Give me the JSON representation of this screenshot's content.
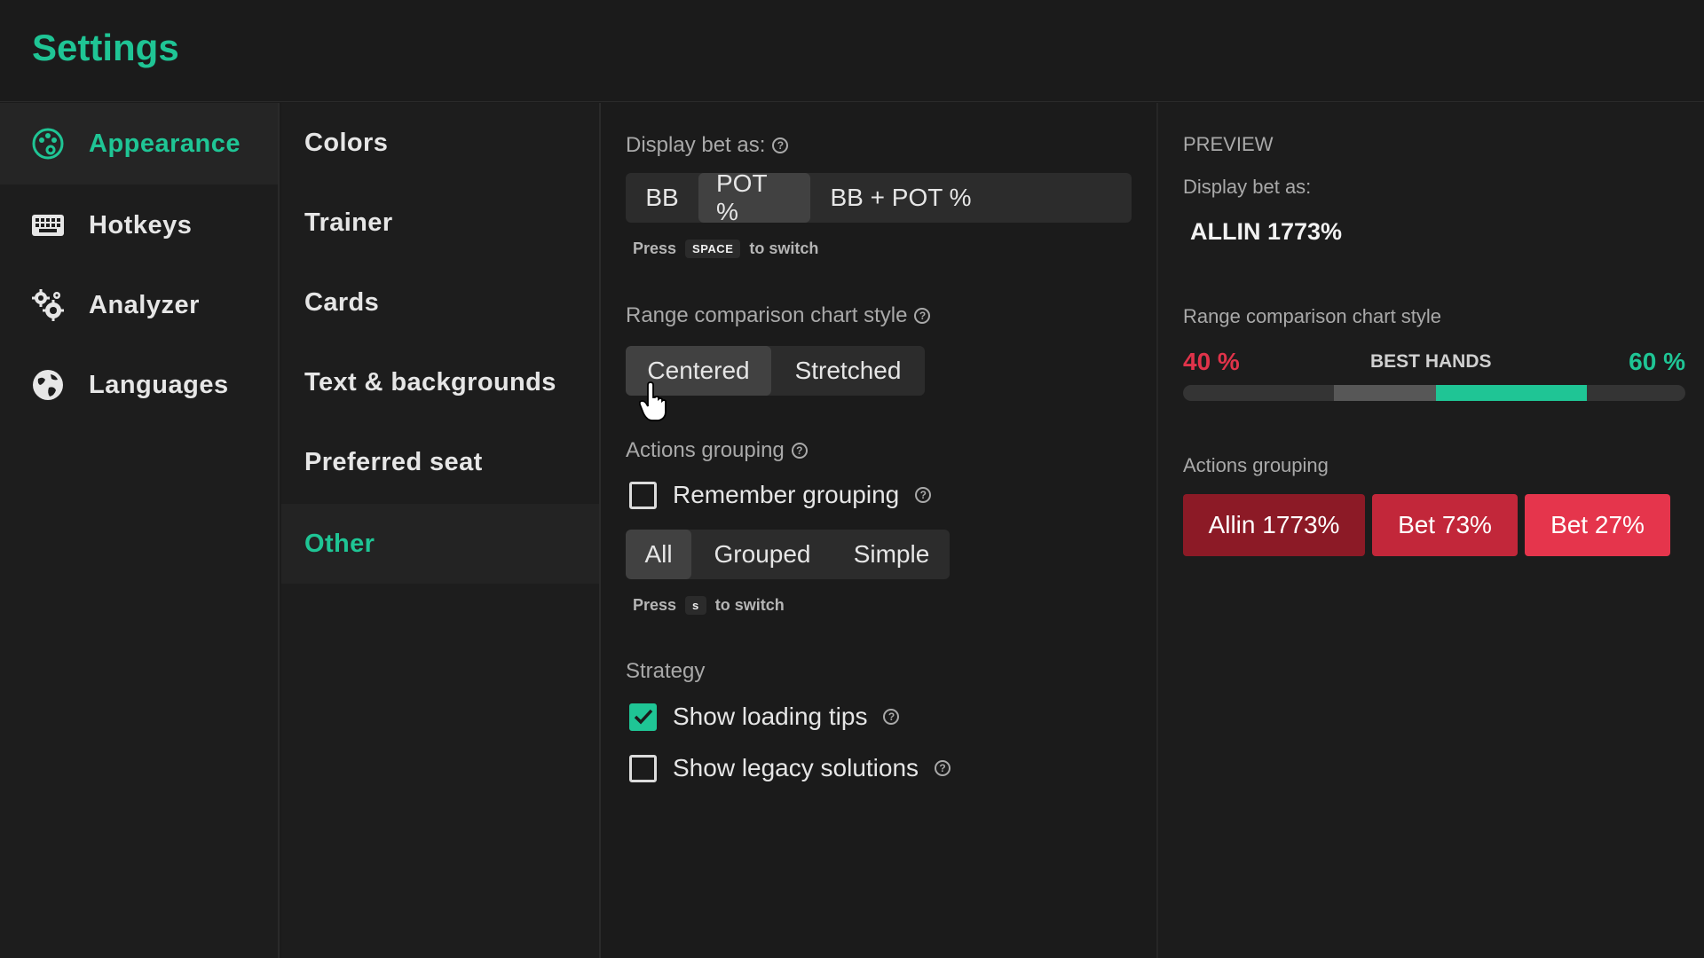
{
  "header": {
    "title": "Settings"
  },
  "sidebar": {
    "items": [
      {
        "label": "Appearance",
        "icon": "palette-icon",
        "active": true
      },
      {
        "label": "Hotkeys",
        "icon": "keyboard-icon",
        "active": false
      },
      {
        "label": "Analyzer",
        "icon": "gears-icon",
        "active": false
      },
      {
        "label": "Languages",
        "icon": "globe-icon",
        "active": false
      }
    ]
  },
  "subnav": {
    "items": [
      {
        "label": "Colors",
        "active": false
      },
      {
        "label": "Trainer",
        "active": false
      },
      {
        "label": "Cards",
        "active": false
      },
      {
        "label": "Text & backgrounds",
        "active": false
      },
      {
        "label": "Preferred seat",
        "active": false
      },
      {
        "label": "Other",
        "active": true
      }
    ]
  },
  "main": {
    "display_bet": {
      "label": "Display bet as:",
      "options": [
        "BB",
        "POT %",
        "BB + POT %"
      ],
      "selected": "POT %",
      "hint_press": "Press",
      "hint_key": "SPACE",
      "hint_suffix": "to switch"
    },
    "range_chart": {
      "label": "Range comparison chart style",
      "options": [
        "Centered",
        "Stretched"
      ],
      "selected": "Centered"
    },
    "actions_grouping": {
      "label": "Actions grouping",
      "remember_label": "Remember grouping",
      "remember_checked": false,
      "options": [
        "All",
        "Grouped",
        "Simple"
      ],
      "selected": "All",
      "hint_press": "Press",
      "hint_key": "s",
      "hint_suffix": "to switch"
    },
    "strategy": {
      "label": "Strategy",
      "loading_tips_label": "Show loading tips",
      "loading_tips_checked": true,
      "legacy_label": "Show legacy solutions",
      "legacy_checked": false
    }
  },
  "preview": {
    "title": "PREVIEW",
    "display_bet_label": "Display bet as:",
    "display_bet_value": "ALLIN 1773%",
    "range_label": "Range comparison chart style",
    "left_pct": "40 %",
    "center_label": "BEST HANDS",
    "right_pct": "60 %",
    "actions_label": "Actions grouping",
    "actions": [
      {
        "label": "Allin 1773%",
        "color": "#8c1a26"
      },
      {
        "label": "Bet 73%",
        "color": "#c2273a"
      },
      {
        "label": "Bet 27%",
        "color": "#e5354c"
      }
    ]
  },
  "colors": {
    "accent": "#1fc595",
    "danger": "#e0334a"
  }
}
